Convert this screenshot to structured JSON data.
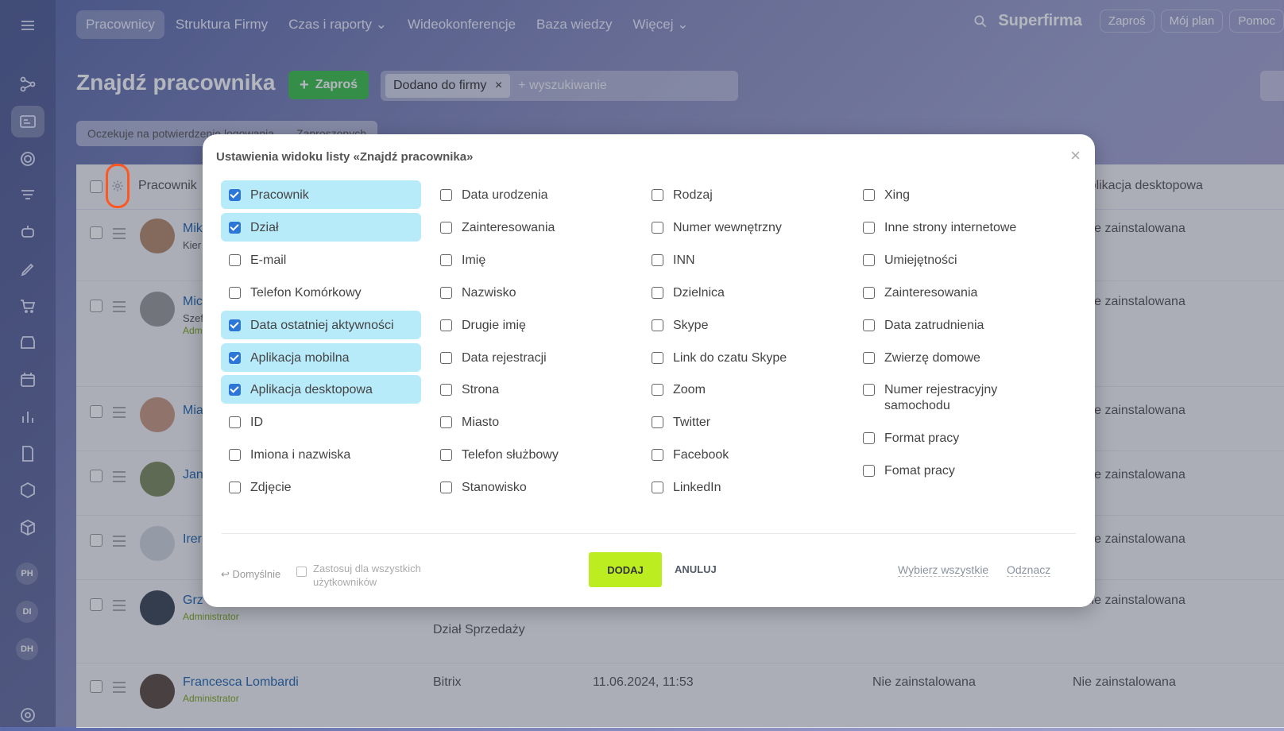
{
  "topnav": {
    "items": [
      "Pracownicy",
      "Struktura Firmy",
      "Czas i raporty",
      "Wideokonferencje",
      "Baza wiedzy",
      "Więcej"
    ],
    "company": "Superfirma",
    "buttons": [
      "Zaproś",
      "Mój plan",
      "Pomoc"
    ]
  },
  "sidebar": {
    "avatars": [
      "PH",
      "DI",
      "DH"
    ]
  },
  "page": {
    "title": "Znajdź pracownika",
    "invite_label": "Zaproś",
    "filter_chip": "Dodano do firmy",
    "search_placeholder": "+ wyszukiwanie",
    "subtabs": [
      "Oczekuje na potwierdzenie logowania",
      "Zaproszonych"
    ]
  },
  "table": {
    "header": {
      "employee": "Pracownik",
      "desktop_app": "Aplikacja desktopowa"
    },
    "rows": [
      {
        "name": "Mik",
        "sub": "Kier",
        "dept": "",
        "date": "",
        "mobile": "",
        "desktop": "Nie zainstalowana"
      },
      {
        "name": "Mic",
        "sub": "Szef",
        "role": "Adm",
        "dept": "",
        "date": "",
        "mobile": "",
        "desktop": "Nie zainstalowana"
      },
      {
        "name": "Mia",
        "dept": "",
        "date": "",
        "mobile": "",
        "desktop": "Nie zainstalowana"
      },
      {
        "name": "Jan",
        "dept": "",
        "date": "",
        "mobile": "",
        "desktop": "Nie zainstalowana"
      },
      {
        "name": "Irer",
        "dept": "",
        "date": "",
        "mobile": "",
        "desktop": "Nie zainstalowana"
      },
      {
        "name": "Grz",
        "role": "Administrator",
        "dept": "Dział Sprzedaży",
        "date": "",
        "mobile": "",
        "desktop": "Nie zainstalowana"
      },
      {
        "name": "Francesca Lombardi",
        "role": "Administrator",
        "dept": "Bitrix",
        "date": "11.06.2024, 11:53",
        "mobile": "Nie zainstalowana",
        "desktop": "Nie zainstalowana"
      }
    ]
  },
  "modal": {
    "title": "Ustawienia widoku listy «Znajdź pracownika»",
    "columns": [
      [
        {
          "label": "Pracownik",
          "checked": true
        },
        {
          "label": "Dział",
          "checked": true
        },
        {
          "label": "E-mail",
          "checked": false
        },
        {
          "label": "Telefon Komórkowy",
          "checked": false
        },
        {
          "label": "Data ostatniej aktywności",
          "checked": true
        },
        {
          "label": "Aplikacja mobilna",
          "checked": true
        },
        {
          "label": "Aplikacja desktopowa",
          "checked": true
        },
        {
          "label": "ID",
          "checked": false
        },
        {
          "label": "Imiona i nazwiska",
          "checked": false
        },
        {
          "label": "Zdjęcie",
          "checked": false
        }
      ],
      [
        {
          "label": "Data urodzenia",
          "checked": false
        },
        {
          "label": "Zainteresowania",
          "checked": false
        },
        {
          "label": "Imię",
          "checked": false
        },
        {
          "label": "Nazwisko",
          "checked": false
        },
        {
          "label": "Drugie imię",
          "checked": false
        },
        {
          "label": "Data rejestracji",
          "checked": false
        },
        {
          "label": "Strona",
          "checked": false
        },
        {
          "label": "Miasto",
          "checked": false
        },
        {
          "label": "Telefon służbowy",
          "checked": false
        },
        {
          "label": "Stanowisko",
          "checked": false
        }
      ],
      [
        {
          "label": "Rodzaj",
          "checked": false
        },
        {
          "label": "Numer wewnętrzny",
          "checked": false
        },
        {
          "label": "INN",
          "checked": false
        },
        {
          "label": "Dzielnica",
          "checked": false
        },
        {
          "label": "Skype",
          "checked": false
        },
        {
          "label": "Link do czatu Skype",
          "checked": false
        },
        {
          "label": "Zoom",
          "checked": false
        },
        {
          "label": "Twitter",
          "checked": false
        },
        {
          "label": "Facebook",
          "checked": false
        },
        {
          "label": "LinkedIn",
          "checked": false
        }
      ],
      [
        {
          "label": "Xing",
          "checked": false
        },
        {
          "label": "Inne strony internetowe",
          "checked": false
        },
        {
          "label": "Umiejętności",
          "checked": false
        },
        {
          "label": "Zainteresowania",
          "checked": false
        },
        {
          "label": "Data zatrudnienia",
          "checked": false
        },
        {
          "label": "Zwierzę domowe",
          "checked": false
        },
        {
          "label": "Numer rejestracyjny samochodu",
          "checked": false
        },
        {
          "label": "Format pracy",
          "checked": false
        },
        {
          "label": "Fomat pracy",
          "checked": false
        }
      ]
    ],
    "footer": {
      "default_label": "Domyślnie",
      "apply_all_label": "Zastosuj dla wszystkich użytkowników",
      "add_label": "DODAJ",
      "cancel_label": "ANULUJ",
      "select_all_label": "Wybierz wszystkie",
      "deselect_label": "Odznacz"
    }
  },
  "colors": {
    "accent_green": "#bbed21",
    "checked_bg": "#b8ebfa",
    "invite_green": "#3bc24b",
    "highlight": "#ff5722"
  }
}
